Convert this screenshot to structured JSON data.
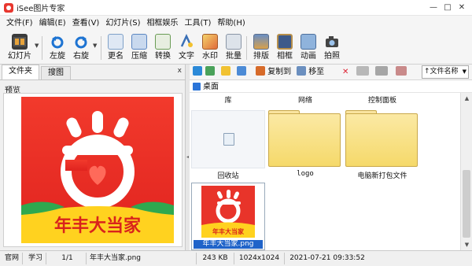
{
  "window": {
    "title": "iSee图片专家",
    "controls": {
      "minimize": "—",
      "restore": "□",
      "close": "✕"
    }
  },
  "menu": [
    "文件(F)",
    "编辑(E)",
    "查看(V)",
    "幻灯片(S)",
    "相框娱乐",
    "工具(T)",
    "帮助(H)"
  ],
  "toolbar": {
    "slideshow": "幻灯片",
    "rotate_left": "左旋",
    "rotate_right": "右旋",
    "rename": "更名",
    "compress": "压缩",
    "convert": "转换",
    "text": "文字",
    "watermark": "水印",
    "batch": "批量",
    "layout": "排版",
    "frame": "相框",
    "animation": "动画",
    "capture": "拍照"
  },
  "left_pane": {
    "tabs": [
      "文件夹",
      "搜图"
    ],
    "close_glyph": "x",
    "preview_label": "预览",
    "preview_image_text": "年丰大当家"
  },
  "navbar": {
    "copy_to": "复制到",
    "move_to": "移至",
    "sort": "↑文件名称"
  },
  "path": "桌面",
  "grid": {
    "headers": [
      "库",
      "网络",
      "控制面板"
    ],
    "items": [
      {
        "label": "回收站",
        "kind": "recycle"
      },
      {
        "label": "logo",
        "kind": "folder"
      },
      {
        "label": "电脑新打包文件",
        "kind": "folder"
      },
      {
        "label": "年丰大当家.png",
        "kind": "image",
        "thumb_text": "年丰大当家"
      }
    ]
  },
  "statusbar": {
    "site": "官网",
    "learn": "学习",
    "index": "1/1",
    "filename": "年丰大当家.png",
    "size": "243 KB",
    "dimensions": "1024x1024",
    "datetime": "2021-07-21 09:33:52"
  },
  "colors": {
    "brand_red": "#e8372f",
    "brand_yellow": "#ffd21f",
    "selection_blue": "#1f63c9"
  }
}
